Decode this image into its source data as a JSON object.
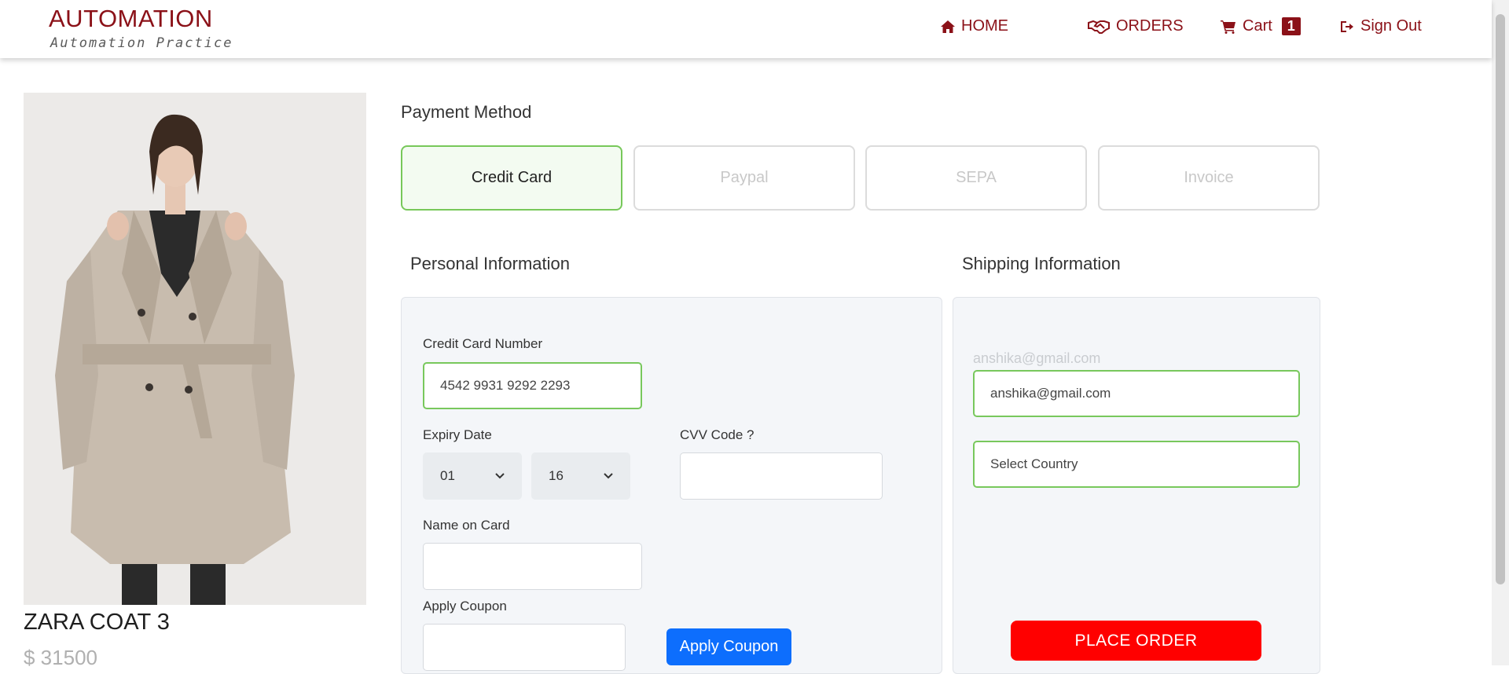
{
  "brand": {
    "title": "AUTOMATION",
    "subtitle": "Automation Practice"
  },
  "nav": {
    "home": "HOME",
    "orders": "ORDERS",
    "cart": "Cart",
    "cart_count": "1",
    "signout": "Sign Out"
  },
  "product": {
    "name": "ZARA COAT 3",
    "price": "$ 31500"
  },
  "payment": {
    "title": "Payment Method",
    "methods": [
      "Credit Card",
      "Paypal",
      "SEPA",
      "Invoice"
    ],
    "active": "Credit Card"
  },
  "personal": {
    "title": "Personal Information",
    "cc_label": "Credit Card Number",
    "cc_value": "4542 9931 9292 2293",
    "expiry_label": "Expiry Date",
    "expiry_month": "01",
    "expiry_year": "16",
    "cvv_label": "CVV Code ?",
    "cvv_value": "",
    "name_label": "Name on Card",
    "name_value": "",
    "coupon_label": "Apply Coupon",
    "coupon_value": "",
    "coupon_button": "Apply Coupon"
  },
  "shipping": {
    "title": "Shipping Information",
    "email_display": "anshika@gmail.com",
    "email_value": "anshika@gmail.com",
    "country_placeholder": "Select Country",
    "place_order": "PLACE ORDER"
  },
  "colors": {
    "brand": "#8b1118",
    "accent_green": "#78c85c",
    "primary_blue": "#0d6efd",
    "order_red": "#ff0000"
  }
}
